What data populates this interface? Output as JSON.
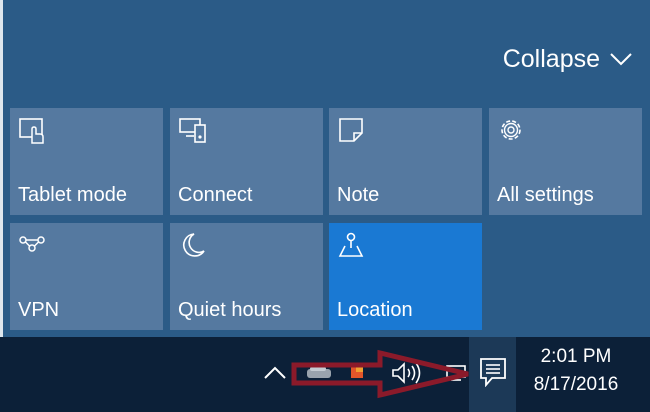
{
  "action_center": {
    "collapse_label": "Collapse",
    "tiles": [
      {
        "label": "Tablet mode",
        "icon": "tablet-mode-icon",
        "active": false
      },
      {
        "label": "Connect",
        "icon": "connect-icon",
        "active": false
      },
      {
        "label": "Note",
        "icon": "note-icon",
        "active": false
      },
      {
        "label": "All settings",
        "icon": "gear-icon",
        "active": false
      },
      {
        "label": "VPN",
        "icon": "vpn-icon",
        "active": false
      },
      {
        "label": "Quiet hours",
        "icon": "moon-icon",
        "active": false
      },
      {
        "label": "Location",
        "icon": "location-icon",
        "active": true
      }
    ]
  },
  "taskbar": {
    "clock_time": "2:01 PM",
    "clock_date": "8/17/2016",
    "tray_icons": [
      "chevron-up-icon",
      "gray-tray-icon",
      "orange-tray-icon",
      "volume-icon",
      "network-icon",
      "action-center-icon"
    ]
  },
  "colors": {
    "panel": "#2b5b87",
    "tile": "#5579a0",
    "tile_active": "#1a79d3",
    "taskbar": "#0c2038",
    "annotation_arrow": "#8b1a2a"
  }
}
